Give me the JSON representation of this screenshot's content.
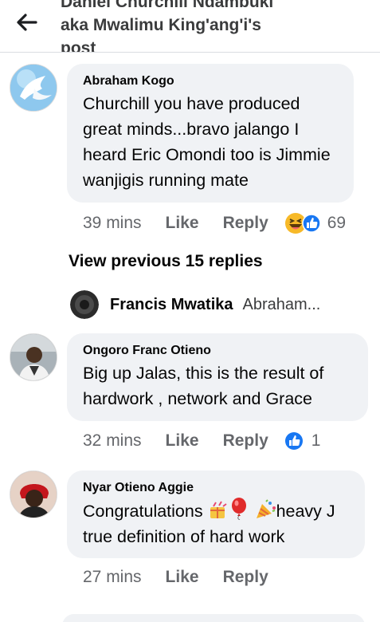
{
  "header": {
    "title_line1": "Daniel Churchill Ndambuki",
    "title_line2": "aka Mwalimu King'ang'i's",
    "title_line3": "post"
  },
  "comments": [
    {
      "author": "Abraham Kogo",
      "text": "Churchill you have produced great minds...bravo jalango I heard Eric Omondi too is Jimmie wanjigis running mate",
      "time": "39 mins",
      "like_label": "Like",
      "reply_label": "Reply",
      "reaction_count": "69"
    },
    {
      "author": "Ongoro Franc Otieno",
      "text": "Big up Jalas, this is the result of hardwork , network and Grace",
      "time": "32 mins",
      "like_label": "Like",
      "reply_label": "Reply",
      "reaction_count": "1"
    },
    {
      "author": "Nyar Otieno Aggie",
      "text_part1": "Congratulations ",
      "text_part2": "heavy J true definition of hard work",
      "time": "27 mins",
      "like_label": "Like",
      "reply_label": "Reply"
    }
  ],
  "view_previous": "View previous 15 replies",
  "reply_preview": {
    "name": "Francis Mwatika",
    "text": "Abraham..."
  },
  "colors": {
    "bubble": "#f0f2f5",
    "meta_text": "#65676b",
    "like_blue": "#1877f2",
    "haha_yellow": "#f7b928"
  },
  "icons": {
    "back": "arrow-left-icon",
    "haha": "haha-reaction-icon",
    "like": "like-reaction-icon",
    "confetti": "confetti-emoji-icon",
    "balloon": "balloon-emoji-icon",
    "party_popper": "party-popper-emoji-icon"
  }
}
